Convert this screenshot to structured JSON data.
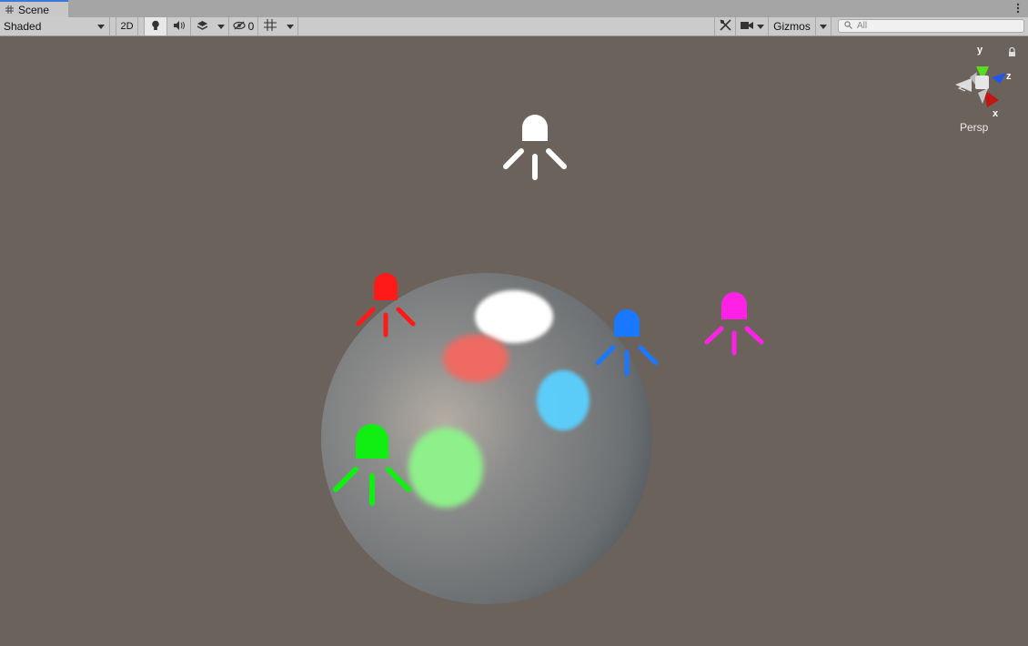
{
  "tab": {
    "title": "Scene"
  },
  "toolbar": {
    "draw_mode": "Shaded",
    "mode_2d": "2D",
    "hidden_count": "0",
    "gizmos": "Gizmos",
    "search_placeholder": "All"
  },
  "gizmo": {
    "label_y": "y",
    "label_z": "z",
    "label_x": "x",
    "projection": "Persp"
  },
  "colors": {
    "scene_bg": "#6b625c",
    "light_white": "#ffffff",
    "light_red": "#ff1a1a",
    "light_blue": "#1a78ff",
    "light_magenta": "#ff22e6",
    "light_green": "#11ee11",
    "accent_tab": "#3a79d8"
  },
  "scene_objects": [
    {
      "type": "sphere",
      "name": "sphere"
    },
    {
      "type": "point-light",
      "color": "white"
    },
    {
      "type": "point-light",
      "color": "red"
    },
    {
      "type": "point-light",
      "color": "blue"
    },
    {
      "type": "point-light",
      "color": "magenta"
    },
    {
      "type": "point-light",
      "color": "green"
    }
  ]
}
